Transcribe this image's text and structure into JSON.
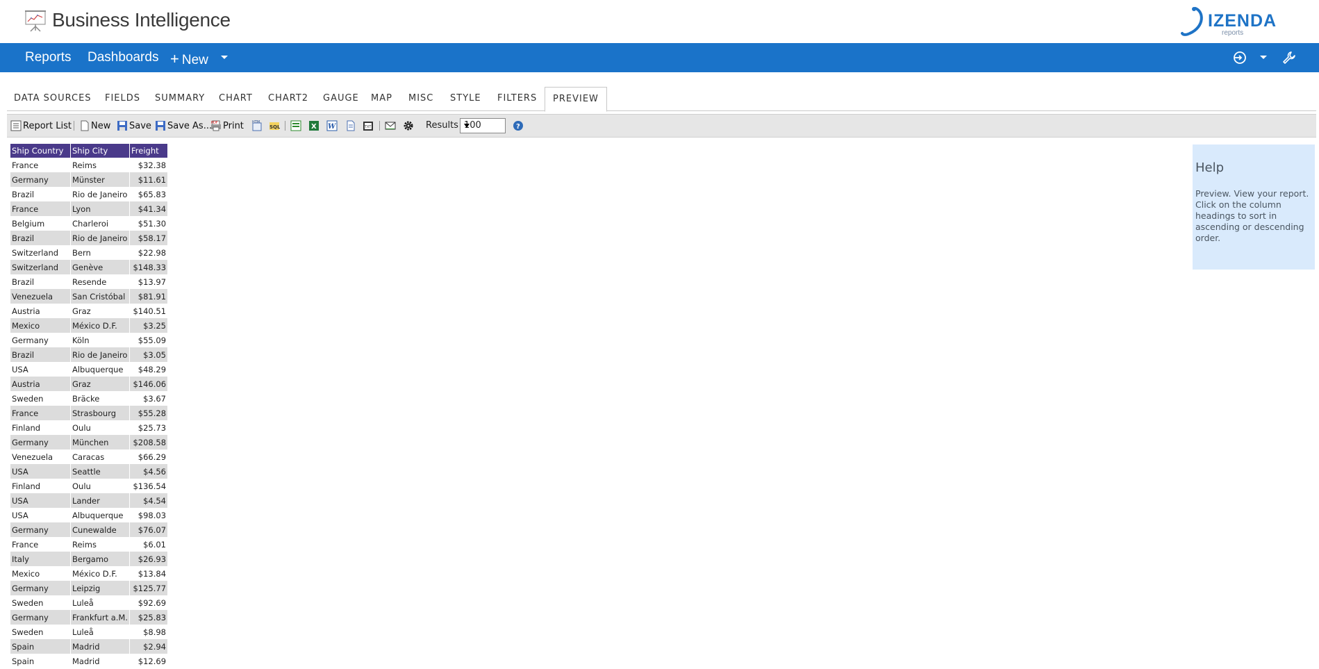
{
  "header": {
    "title": "Business Intelligence",
    "brand_name": "IZENDA",
    "brand_sub": "reports"
  },
  "nav": {
    "reports": "Reports",
    "dashboards": "Dashboards",
    "new": "New"
  },
  "tabs": [
    "DATA SOURCES",
    "FIELDS",
    "SUMMARY",
    "CHART",
    "CHART2",
    "GAUGE",
    "MAP",
    "MISC",
    "STYLE",
    "FILTERS",
    "PREVIEW"
  ],
  "toolbar": {
    "report_list": "Report List",
    "new": "New",
    "save": "Save",
    "save_as": "Save As...",
    "print": "Print",
    "results_label": "Results",
    "results_value": "100"
  },
  "table": {
    "headers": [
      "Ship Country",
      "Ship City",
      "Freight"
    ],
    "rows": [
      [
        "France",
        "Reims",
        "$32.38"
      ],
      [
        "Germany",
        "Münster",
        "$11.61"
      ],
      [
        "Brazil",
        "Rio de Janeiro",
        "$65.83"
      ],
      [
        "France",
        "Lyon",
        "$41.34"
      ],
      [
        "Belgium",
        "Charleroi",
        "$51.30"
      ],
      [
        "Brazil",
        "Rio de Janeiro",
        "$58.17"
      ],
      [
        "Switzerland",
        "Bern",
        "$22.98"
      ],
      [
        "Switzerland",
        "Genève",
        "$148.33"
      ],
      [
        "Brazil",
        "Resende",
        "$13.97"
      ],
      [
        "Venezuela",
        "San Cristóbal",
        "$81.91"
      ],
      [
        "Austria",
        "Graz",
        "$140.51"
      ],
      [
        "Mexico",
        "México D.F.",
        "$3.25"
      ],
      [
        "Germany",
        "Köln",
        "$55.09"
      ],
      [
        "Brazil",
        "Rio de Janeiro",
        "$3.05"
      ],
      [
        "USA",
        "Albuquerque",
        "$48.29"
      ],
      [
        "Austria",
        "Graz",
        "$146.06"
      ],
      [
        "Sweden",
        "Bräcke",
        "$3.67"
      ],
      [
        "France",
        "Strasbourg",
        "$55.28"
      ],
      [
        "Finland",
        "Oulu",
        "$25.73"
      ],
      [
        "Germany",
        "München",
        "$208.58"
      ],
      [
        "Venezuela",
        "Caracas",
        "$66.29"
      ],
      [
        "USA",
        "Seattle",
        "$4.56"
      ],
      [
        "Finland",
        "Oulu",
        "$136.54"
      ],
      [
        "USA",
        "Lander",
        "$4.54"
      ],
      [
        "USA",
        "Albuquerque",
        "$98.03"
      ],
      [
        "Germany",
        "Cunewalde",
        "$76.07"
      ],
      [
        "France",
        "Reims",
        "$6.01"
      ],
      [
        "Italy",
        "Bergamo",
        "$26.93"
      ],
      [
        "Mexico",
        "México D.F.",
        "$13.84"
      ],
      [
        "Germany",
        "Leipzig",
        "$125.77"
      ],
      [
        "Sweden",
        "Luleå",
        "$92.69"
      ],
      [
        "Germany",
        "Frankfurt a.M.",
        "$25.83"
      ],
      [
        "Sweden",
        "Luleå",
        "$8.98"
      ],
      [
        "Spain",
        "Madrid",
        "$2.94"
      ],
      [
        "Spain",
        "Madrid",
        "$12.69"
      ]
    ]
  },
  "help": {
    "title": "Help",
    "text": "Preview. View your report. Click on the column headings to sort in ascending or descending order."
  },
  "colors": {
    "nav_bg": "#1a73c9",
    "table_header_bg": "#4a3a8a",
    "help_bg": "#d9eafc",
    "brand": "#1e73c6"
  }
}
